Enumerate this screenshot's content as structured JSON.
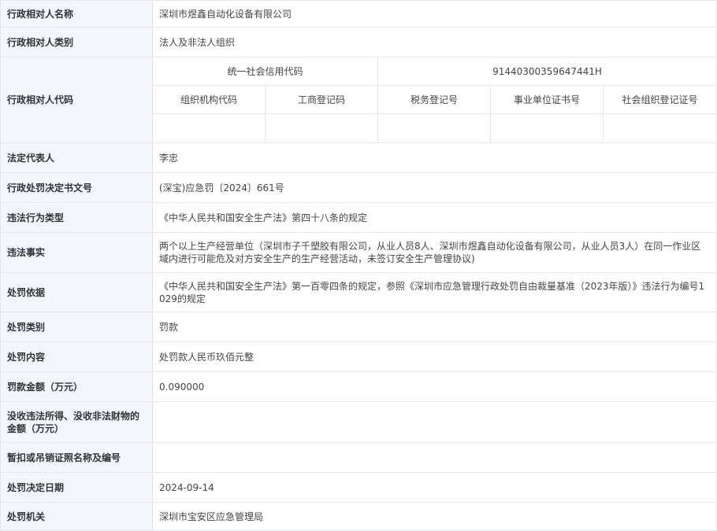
{
  "rows": {
    "party_name": {
      "label": "行政相对人名称",
      "value": "深圳市煜鑫自动化设备有限公司"
    },
    "party_type": {
      "label": "行政相对人类别",
      "value": "法人及非法人组织"
    },
    "party_code": {
      "label": "行政相对人代码",
      "credit_code_header": "统一社会信用代码",
      "credit_code_value": "91440300359647441H",
      "sub_headers": [
        "组织机构代码",
        "工商登记码",
        "税务登记号",
        "事业单位证书号",
        "社会组织登记证号"
      ],
      "sub_values": [
        "",
        "",
        "",
        "",
        ""
      ]
    },
    "legal_rep": {
      "label": "法定代表人",
      "value": "李忠"
    },
    "decision_no": {
      "label": "行政处罚决定书文号",
      "value": "(深宝)应急罚〔2024〕661号"
    },
    "violation_type": {
      "label": "违法行为类型",
      "value": "《中华人民共和国安全生产法》第四十八条的规定"
    },
    "facts": {
      "label": "违法事实",
      "value": "两个以上生产经营单位（深圳市子千塑胶有限公司，从业人员8人、深圳市煜鑫自动化设备有限公司，从业人员3人）在同一作业区域内进行可能危及对方安全生产的生产经营活动，未签订安全生产管理协议)"
    },
    "basis": {
      "label": "处罚依据",
      "value": "《中华人民共和国安全生产法》第一百零四条的规定，参照《深圳市应急管理行政处罚自由裁量基准（2023年版）》违法行为编号1029的规定"
    },
    "penalty_category": {
      "label": "处罚类别",
      "value": "罚款"
    },
    "penalty_content": {
      "label": "处罚内容",
      "value": "处罚款人民币玖佰元整"
    },
    "fine_amount": {
      "label": "罚款金额（万元）",
      "value": "0.090000"
    },
    "confiscation": {
      "label": "没收违法所得、没收非法财物的金额（万元）",
      "value": ""
    },
    "suspension": {
      "label": "暂扣或吊销证照名称及编号",
      "value": ""
    },
    "decision_date": {
      "label": "处罚决定日期",
      "value": "2024-09-14"
    },
    "authority": {
      "label": "处罚机关",
      "value": "深圳市宝安区应急管理局"
    }
  }
}
